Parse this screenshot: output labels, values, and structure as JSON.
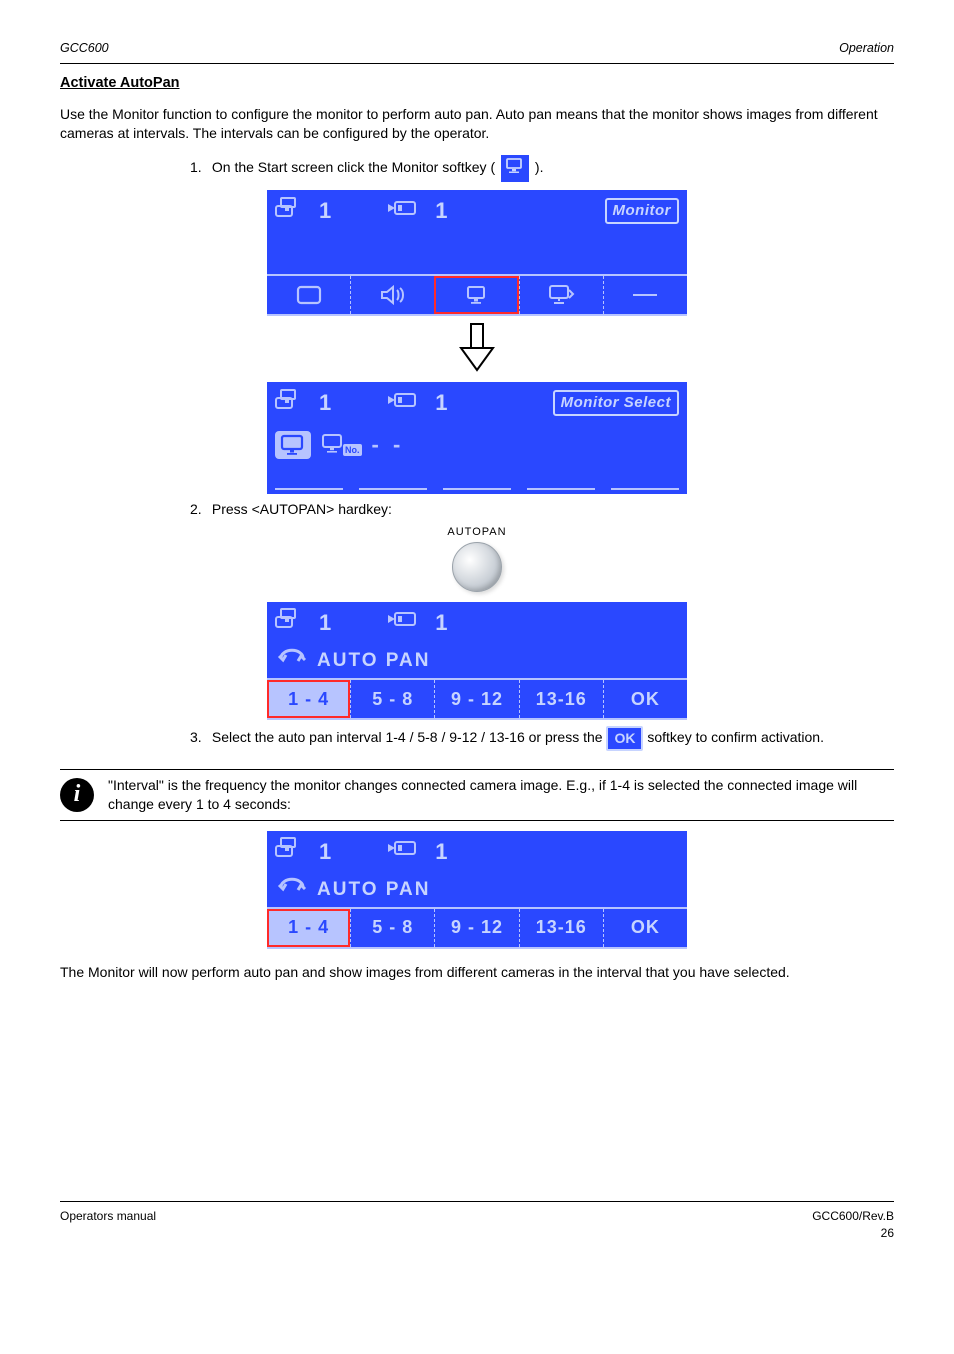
{
  "page_header": {
    "left": "GCC600",
    "right": "Operation"
  },
  "section_title": "Activate AutoPan",
  "intro": "Use the Monitor function to configure the monitor to perform auto pan. Auto pan means that the monitor shows images from different cameras at intervals. The intervals can be configured by the operator.",
  "steps": {
    "s1": "On the Start screen click the Monitor softkey (",
    "s1_end": ").",
    "s2": "Press <AUTOPAN> hardkey:",
    "s3_a": "Select the auto pan interval 1-4 / 5-8 / 9-12 / 13-16 or press the ",
    "s3_b": " softkey to confirm activation."
  },
  "lcd1": {
    "status_num1": "1",
    "status_num2": "1",
    "title": "Monitor"
  },
  "lcd2": {
    "status_num1": "1",
    "status_num2": "1",
    "title": "Monitor Select",
    "no_label": "No.",
    "dashes": "- -"
  },
  "autopan_label": "AUTOPAN",
  "lcd3": {
    "status_num1": "1",
    "status_num2": "1",
    "title": "AUTO PAN",
    "tabs": [
      "1 - 4",
      "5 - 8",
      "9 - 12",
      "13-16",
      "OK"
    ]
  },
  "info_text": "\"Interval\" is the frequency the monitor changes connected camera image. E.g., if 1-4 is selected the connected image will change every 1 to 4 seconds:",
  "lcd4": {
    "status_num1": "1",
    "status_num2": "1",
    "title": "AUTO PAN",
    "tabs": [
      "1 - 4",
      "5 - 8",
      "9 - 12",
      "13-16",
      "OK"
    ]
  },
  "closing": "The Monitor will now perform auto pan and show images from different cameras in the interval that you have selected.",
  "ok_label": "OK",
  "footer": {
    "left": "Operators manual",
    "right_line": "GCC600/Rev.B",
    "page": "26"
  }
}
